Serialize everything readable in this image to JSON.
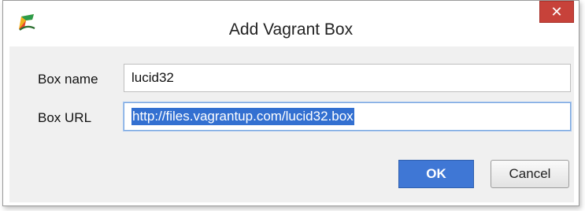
{
  "dialog": {
    "title": "Add Vagrant Box",
    "close_glyph": "✕",
    "app_icon": "intellij-idea-icon"
  },
  "form": {
    "box_name_label": "Box name",
    "box_name_value": "lucid32",
    "box_url_label": "Box URL",
    "box_url_value": "http://files.vagrantup.com/lucid32.box"
  },
  "buttons": {
    "ok_label": "OK",
    "cancel_label": "Cancel"
  },
  "colors": {
    "close_button": "#c7423a",
    "ok_button": "#3f77d5",
    "selection": "#3370d1"
  }
}
